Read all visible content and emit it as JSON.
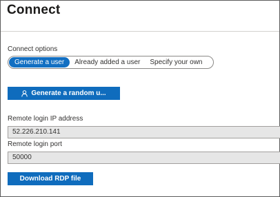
{
  "page": {
    "title": "Connect"
  },
  "connect_options": {
    "label": "Connect options",
    "options": [
      {
        "label": "Generate a user",
        "selected": true
      },
      {
        "label": "Already added a user",
        "selected": false
      },
      {
        "label": "Specify your own",
        "selected": false
      }
    ]
  },
  "generate_button": {
    "label": "Generate a random u...",
    "icon": "person-icon"
  },
  "remote_ip": {
    "label": "Remote login IP address",
    "value": "52.226.210.141"
  },
  "remote_port": {
    "label": "Remote login port",
    "value": "50000"
  },
  "download_button": {
    "label": "Download RDP file"
  },
  "colors": {
    "accent": "#0f6cbd",
    "field_background": "#e6e6e6"
  }
}
